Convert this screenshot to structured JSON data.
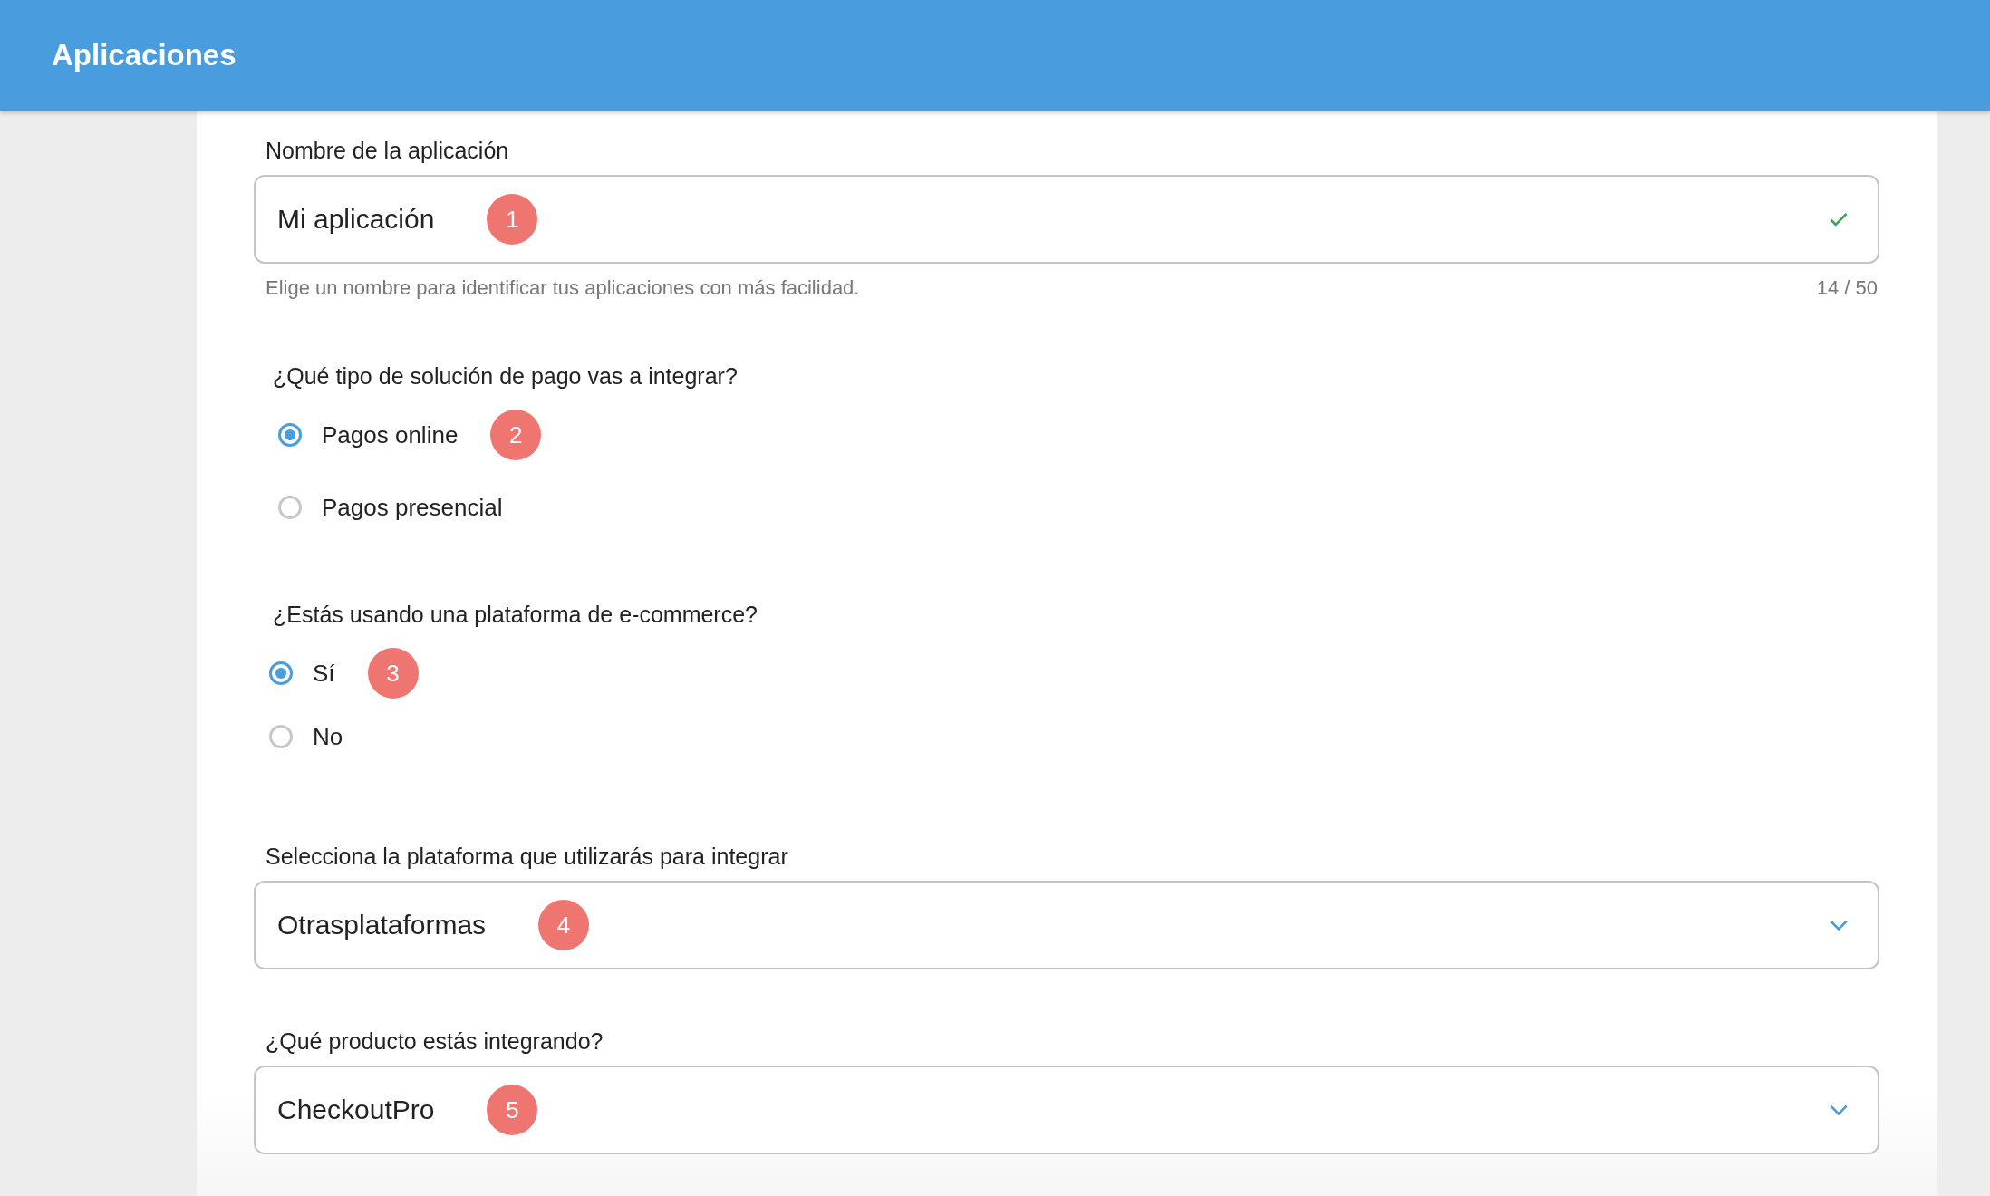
{
  "header": {
    "title": "Aplicaciones"
  },
  "form": [
    {
      "kind": "text_field",
      "label": "Nombre de la aplicación",
      "value": "Mi aplicación",
      "marker": "1",
      "valid": true,
      "helper": "Elige un nombre para identificar tus aplicaciones con más facilidad.",
      "counter": "14 / 50"
    },
    {
      "kind": "radio_group",
      "question": "¿Qué tipo de solución de pago vas a integrar?",
      "options": [
        {
          "label": "Pagos online",
          "selected": true,
          "marker": "2"
        },
        {
          "label": "Pagos presencial",
          "selected": false
        }
      ]
    },
    {
      "kind": "radio_group",
      "question": "¿Estás usando una plataforma de e-commerce?",
      "options": [
        {
          "label": "Sí",
          "selected": true,
          "marker": "3"
        },
        {
          "label": "No",
          "selected": false
        }
      ]
    },
    {
      "kind": "select",
      "label": "Selecciona la plataforma que utilizarás para integrar",
      "value": "Otrasplataformas",
      "marker": "4"
    },
    {
      "kind": "select",
      "label": "¿Qué producto estás integrando?",
      "value": "CheckoutPro",
      "marker": "5"
    }
  ]
}
